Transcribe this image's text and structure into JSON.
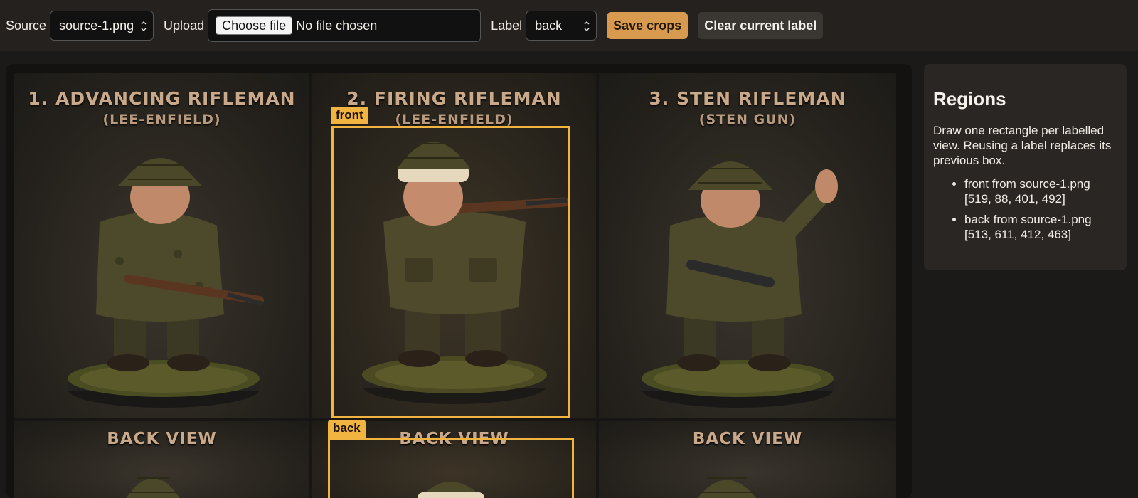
{
  "toolbar": {
    "source_label": "Source",
    "source_value": "source-1.png",
    "upload_label": "Upload",
    "choose_file_label": "Choose file",
    "file_status": "No file chosen",
    "label_label": "Label",
    "label_value": "back",
    "save_button": "Save crops",
    "clear_button": "Clear current label"
  },
  "image": {
    "panels": [
      {
        "title": "1. ADVANCING RIFLEMAN",
        "subtitle": "(LEE-ENFIELD)"
      },
      {
        "title": "2. FIRING RIFLEMAN",
        "subtitle": "(LEE-ENFIELD)"
      },
      {
        "title": "3. STEN RIFLEMAN",
        "subtitle": "(STEN GUN)"
      }
    ],
    "bottom_panels": [
      {
        "title": "BACK VIEW"
      },
      {
        "title": "BACK VIEW"
      },
      {
        "title": "BACK VIEW"
      }
    ]
  },
  "crops": [
    {
      "label": "front"
    },
    {
      "label": "back"
    }
  ],
  "sidebar": {
    "title": "Regions",
    "description": "Draw one rectangle per labelled view. Reusing a label replaces its previous box.",
    "regions": [
      "front from source-1.png [519, 88, 401, 492]",
      "back from source-1.png [513, 611, 412, 463]"
    ]
  },
  "colors": {
    "accent": "#d89a4e",
    "crop_outline": "#f2b441",
    "background": "#1c1a18"
  }
}
